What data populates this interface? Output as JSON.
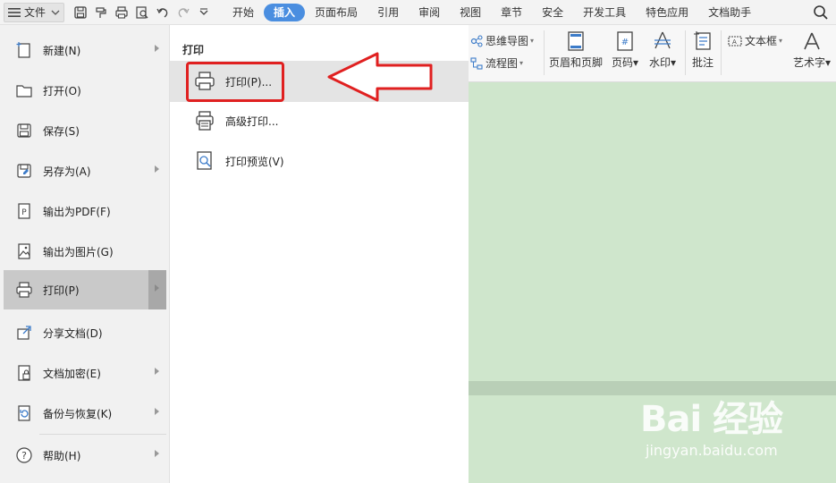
{
  "topbar": {
    "file_label": "文件",
    "tabs": [
      "开始",
      "插入",
      "页面布局",
      "引用",
      "审阅",
      "视图",
      "章节",
      "安全",
      "开发工具",
      "特色应用",
      "文档助手"
    ],
    "active_tab": "插入",
    "accent_color": "#4a8ee0"
  },
  "ribbon": {
    "mindmap_label": "思维导图",
    "flowchart_label": "流程图",
    "header_footer_label": "页眉和页脚",
    "page_number_label": "页码",
    "watermark_label": "水印",
    "comment_label": "批注",
    "textbox_label": "文本框",
    "wordart_label": "艺术字"
  },
  "file_menu": {
    "items": [
      {
        "label": "新建(N)",
        "icon": "new-doc-icon",
        "has_arrow": true
      },
      {
        "label": "打开(O)",
        "icon": "folder-icon",
        "has_arrow": false
      },
      {
        "label": "保存(S)",
        "icon": "save-icon",
        "has_arrow": false
      },
      {
        "label": "另存为(A)",
        "icon": "save-as-icon",
        "has_arrow": true
      },
      {
        "label": "输出为PDF(F)",
        "icon": "pdf-export-icon",
        "has_arrow": false
      },
      {
        "label": "输出为图片(G)",
        "icon": "image-export-icon",
        "has_arrow": false
      },
      {
        "label": "打印(P)",
        "icon": "printer-icon",
        "has_arrow": true,
        "selected": true
      },
      {
        "label": "分享文档(D)",
        "icon": "share-icon",
        "has_arrow": false
      },
      {
        "label": "文档加密(E)",
        "icon": "encrypt-icon",
        "has_arrow": true
      },
      {
        "label": "备份与恢复(K)",
        "icon": "backup-icon",
        "has_arrow": true
      },
      {
        "label": "帮助(H)",
        "icon": "help-icon",
        "has_arrow": true
      }
    ]
  },
  "print_submenu": {
    "title": "打印",
    "items": [
      {
        "label": "打印(P)...",
        "icon": "printer-icon",
        "highlighted": true
      },
      {
        "label": "高级打印...",
        "icon": "advanced-print-icon"
      },
      {
        "label": "打印预览(V)",
        "icon": "print-preview-icon"
      }
    ]
  },
  "annotation": {
    "color": "#e02020"
  },
  "watermark": {
    "logo_text": "Bai 经验",
    "url": "jingyan.baidu.com"
  }
}
